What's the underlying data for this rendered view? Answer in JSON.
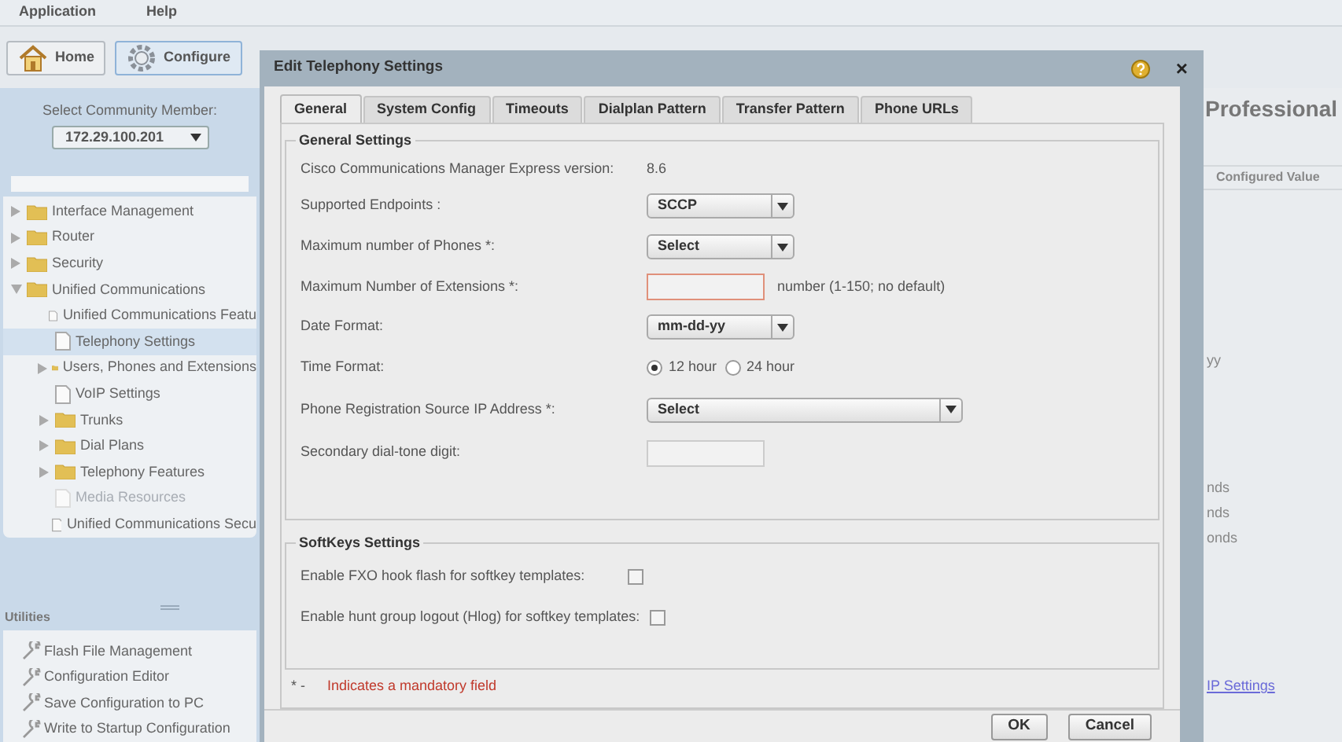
{
  "menu": [
    "Application",
    "Help"
  ],
  "toolbar": [
    {
      "label": "Home",
      "selected": false
    },
    {
      "label": "Configure",
      "selected": true
    }
  ],
  "community": {
    "label": "Select Community Member:",
    "value": "172.29.100.201"
  },
  "tree": [
    {
      "label": "Interface Management",
      "kind": "folder",
      "expanded": false,
      "selected": false,
      "disabled": false
    },
    {
      "label": "Router",
      "kind": "folder",
      "expanded": false,
      "selected": false,
      "disabled": false
    },
    {
      "label": "Security",
      "kind": "folder",
      "expanded": false,
      "selected": false,
      "disabled": false
    },
    {
      "label": "Unified Communications",
      "kind": "folder",
      "expanded": true,
      "selected": false,
      "disabled": false,
      "children": [
        {
          "label": "Unified Communications Featu",
          "kind": "page",
          "selected": false,
          "disabled": false
        },
        {
          "label": "Telephony Settings",
          "kind": "page",
          "selected": true,
          "disabled": false
        },
        {
          "label": "Users, Phones and Extensions",
          "kind": "folder",
          "expanded": false,
          "selected": false,
          "disabled": false
        },
        {
          "label": "VoIP Settings",
          "kind": "page",
          "selected": false,
          "disabled": false
        },
        {
          "label": "Trunks",
          "kind": "folder",
          "expanded": false,
          "selected": false,
          "disabled": false
        },
        {
          "label": "Dial Plans",
          "kind": "folder",
          "expanded": false,
          "selected": false,
          "disabled": false
        },
        {
          "label": "Telephony Features",
          "kind": "folder",
          "expanded": false,
          "selected": false,
          "disabled": false
        },
        {
          "label": "Media Resources",
          "kind": "page",
          "selected": false,
          "disabled": true
        },
        {
          "label": "Unified Communications Secu",
          "kind": "page",
          "selected": false,
          "disabled": false
        }
      ]
    }
  ],
  "utilities": {
    "title": "Utilities",
    "items": [
      "Flash File Management",
      "Configuration Editor",
      "Save Configuration to PC",
      "Write to Startup Configuration"
    ]
  },
  "background": {
    "title": "Professional",
    "column_header": "Configured Value",
    "fragments": [
      "yy",
      "nds",
      "nds",
      "onds"
    ],
    "link": "IP Settings"
  },
  "dialog": {
    "title": "Edit Telephony Settings",
    "close": "×",
    "tabs": [
      {
        "label": "General",
        "selected": true
      },
      {
        "label": "System Config",
        "selected": false
      },
      {
        "label": "Timeouts",
        "selected": false
      },
      {
        "label": "Dialplan Pattern",
        "selected": false
      },
      {
        "label": "Transfer Pattern",
        "selected": false
      },
      {
        "label": "Phone URLs",
        "selected": false
      }
    ],
    "general": {
      "title": "General Settings",
      "rows": [
        {
          "kind": "text",
          "label": "Cisco Communications Manager Express version:",
          "value": "8.6"
        },
        {
          "kind": "select",
          "label": "Supported Endpoints :",
          "value": "SCCP",
          "wide": false
        },
        {
          "kind": "select",
          "label": "Maximum number of Phones *:",
          "value": "Select",
          "wide": false
        },
        {
          "kind": "input",
          "label": "Maximum Number of Extensions *:",
          "invalid": true,
          "hint": "number (1-150; no default)"
        },
        {
          "kind": "select",
          "label": "Date Format:",
          "value": "mm-dd-yy",
          "wide": false
        },
        {
          "kind": "radio",
          "label": "Time Format:",
          "options": [
            {
              "label": "12 hour",
              "selected": true
            },
            {
              "label": "24 hour",
              "selected": false
            }
          ]
        },
        {
          "kind": "select",
          "label": "Phone Registration Source IP Address *:",
          "value": "Select",
          "wide": true
        },
        {
          "kind": "input",
          "label": "Secondary dial-tone digit:",
          "invalid": false
        }
      ]
    },
    "softkeys": {
      "title": "SoftKeys Settings",
      "rows": [
        {
          "label": "Enable FXO hook flash for softkey templates:",
          "checked": false
        },
        {
          "label": "Enable hunt group logout (Hlog) for softkey templates:",
          "checked": false
        }
      ]
    },
    "mandatory": {
      "mark": "* -",
      "text": "Indicates a mandatory field"
    },
    "buttons": [
      "OK",
      "Cancel"
    ]
  }
}
